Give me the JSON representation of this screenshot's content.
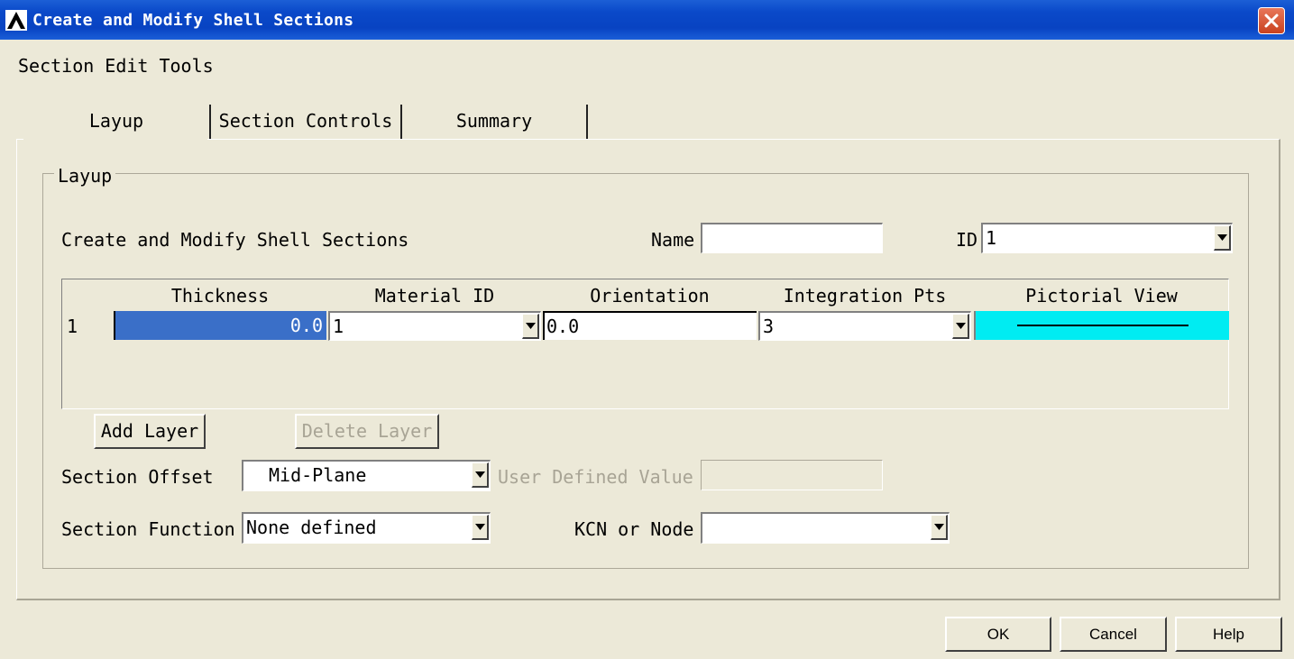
{
  "window": {
    "title": "Create and Modify Shell Sections",
    "close_icon": "close-icon"
  },
  "menu": [
    "Section",
    "Edit",
    "Tools"
  ],
  "tabs": [
    "Layup",
    "Section Controls",
    "Summary"
  ],
  "layup": {
    "group_title": "Layup",
    "heading": "Create and Modify Shell Sections",
    "name_label": "Name",
    "name_value": "",
    "id_label": "ID",
    "id_value": "1",
    "columns": [
      "Thickness",
      "Material ID",
      "Orientation",
      "Integration Pts",
      "Pictorial View"
    ],
    "rows": [
      {
        "num": "1",
        "thickness": "0.0",
        "material_id": "1",
        "orientation": "0.0",
        "integration_pts": "3"
      }
    ],
    "add_layer": "Add Layer",
    "delete_layer": "Delete Layer",
    "section_offset_label": "Section Offset",
    "section_offset_value": "Mid-Plane",
    "user_defined_label": "User Defined Value",
    "user_defined_value": "",
    "section_function_label": "Section Function",
    "section_function_value": "None defined",
    "kcn_label": "KCN or Node",
    "kcn_value": ""
  },
  "buttons": {
    "ok": "OK",
    "cancel": "Cancel",
    "help": "Help"
  },
  "colors": {
    "selected_cell": "#3a6fc8",
    "pictorial_bg": "#00ecf2",
    "titlebar": "#0a49c9"
  }
}
